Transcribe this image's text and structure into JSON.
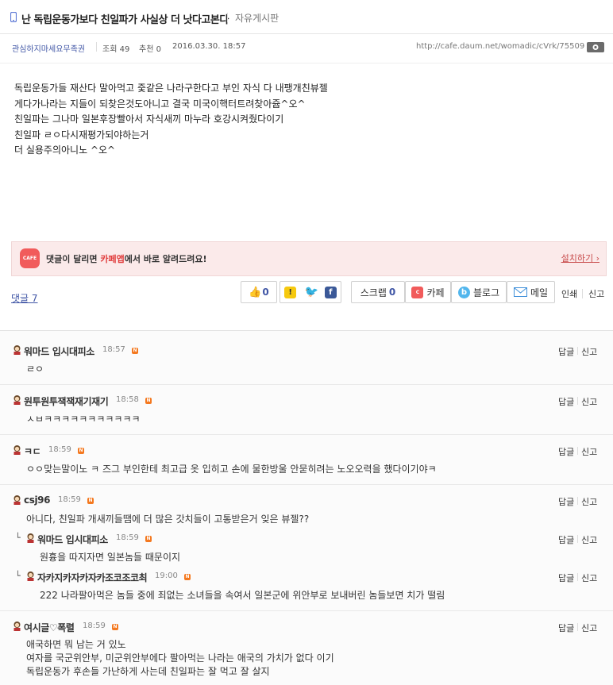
{
  "post": {
    "title": "난 독립운동가보다 친일파가 사실상 더 낫다고본다",
    "board": "자유게시판",
    "author": "관심하지마세요무족권",
    "views_label": "조회",
    "views": "49",
    "recommend_label": "추천",
    "recommend": "0",
    "datetime": "2016.03.30. 18:57",
    "url": "http://cafe.daum.net/womadic/cVrk/75509",
    "body": [
      "독립운동가들 재산다 말아먹고 줒같은 나라구한다고 부인 자식 다 내팽개친뷰젤",
      "게다가나라는 지들이 되찾은것도아니고 결국 미국이핵터트려찾아쥽^오^",
      "친일파는 그나마 일본후장빨아서 자식새끼 마누라 호강시켜줬다이기",
      "친일파 ㄹㅇ다시재평가되야하는거",
      "더 실용주의아니노 ^오^"
    ]
  },
  "notice": {
    "icon": "CAFE",
    "text_pre": "댓글이 달리면 ",
    "text_hl": "카페앱",
    "text_post": "에서 바로 알려드려요!",
    "install": "설치하기"
  },
  "toolbar": {
    "comments_label": "댓글 7",
    "like_count": "0",
    "scrap_label": "스크랩",
    "scrap_count": "0",
    "cafe_label": "카페",
    "blog_label": "블로그",
    "mail_label": "메일",
    "print_label": "인쇄",
    "report_label": "신고"
  },
  "comment_actions": {
    "reply": "답글",
    "report": "신고"
  },
  "new_badge": "N",
  "comments": [
    {
      "nick": "워마드 입시대피소",
      "time": "18:57",
      "lines": [
        "ㄹㅇ"
      ]
    },
    {
      "nick": "원투원투잭잭재기재기",
      "time": "18:58",
      "lines": [
        "ㅅㅂㅋㅋㅋㅋㅋㅋㅋㅋㅋㅋㅋ"
      ]
    },
    {
      "nick": "ㅋㄷ",
      "time": "18:59",
      "lines": [
        "ㅇㅇ맞는말이노 ㅋ 즈그 부인한테 최고급 옷 입히고 손에 물한방울 안묻히려는 노오오력을 했다이기야ㅋ"
      ]
    },
    {
      "nick": "csj96",
      "time": "18:59",
      "lines": [
        "아니다, 친일파 개새끼들땜에 더 많은 갓치들이 고통받은거 잊은 뷰젤??"
      ]
    },
    {
      "nick": "워마드 입시대피소",
      "time": "18:59",
      "lines": [
        "원흉을 따지자면 일본놈들 때문이지"
      ],
      "reply": true
    },
    {
      "nick": "자카지카자카자카조코조코최",
      "time": "19:00",
      "lines": [
        "222 나라팔아먹은 놈들 중에 죄없는 소녀들을 속여서 일본군에 위안부로 보내버린 놈들보면 치가 떨림"
      ],
      "reply": true
    },
    {
      "nick": "여시글♡폭렬",
      "time": "18:59",
      "lines": [
        "애국하면 뭐 남는 거 있노",
        "여자를 국군위안부, 미군위안부에다 팔아먹는 나라는 애국의 가치가 없다 이기",
        "독립운동가 후손들 가난하게 사는데 친일파는 잘 먹고 잘 살지"
      ]
    }
  ],
  "colors": {
    "accent": "#3f55a5",
    "notice_bg": "#fbeaea",
    "cafe_red": "#f15b5b",
    "new_orange": "#f47920"
  }
}
